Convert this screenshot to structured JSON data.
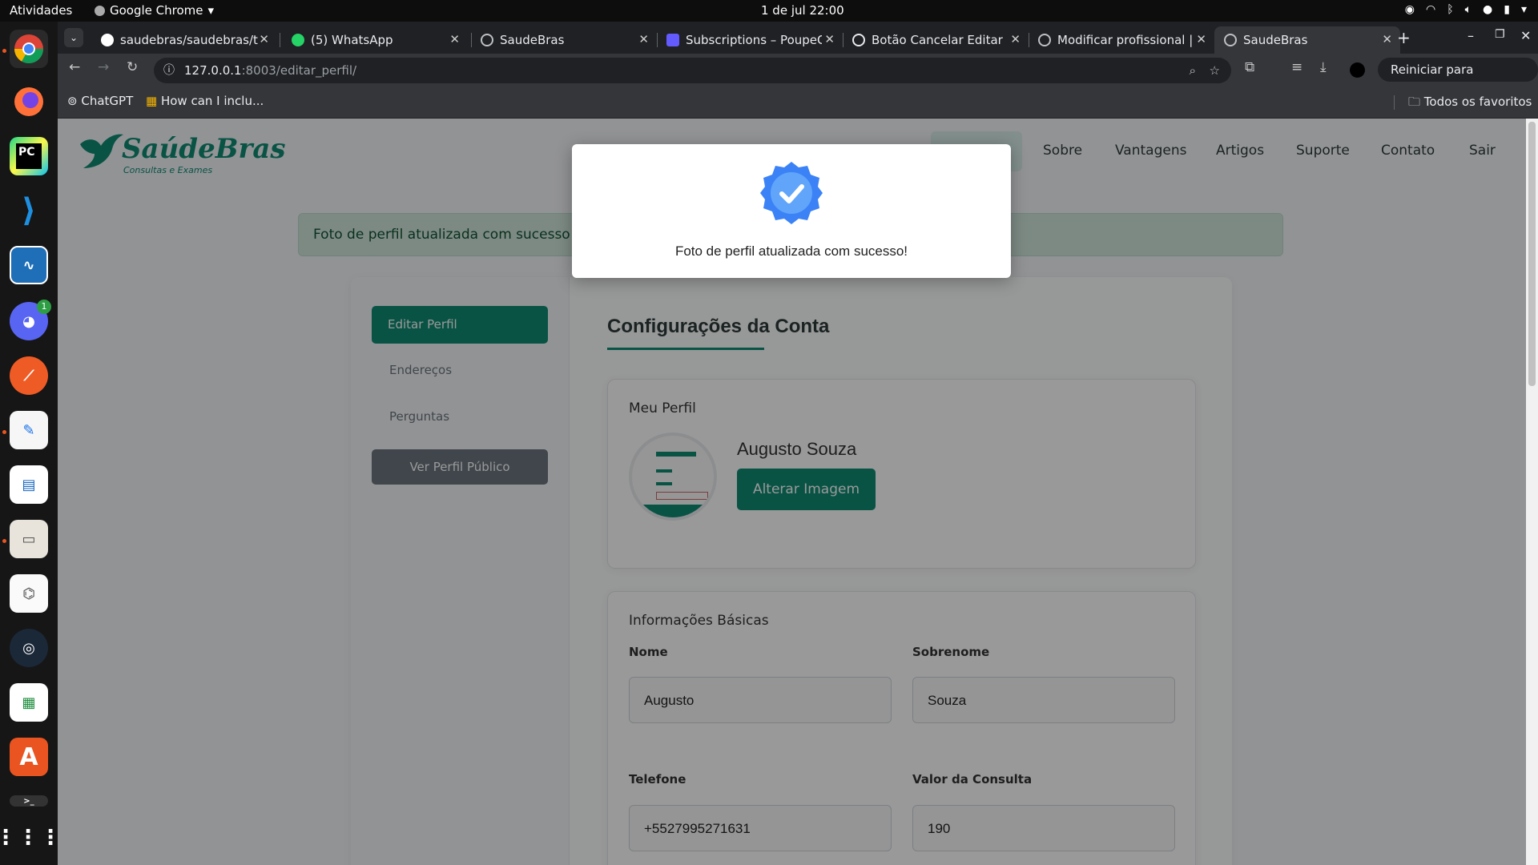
{
  "os": {
    "activities": "Atividades",
    "app_name": "Google Chrome",
    "clock": "1 de jul  22:00",
    "discord_badge": "1"
  },
  "browser": {
    "tabs": [
      {
        "title": "saudebras/saudebras/t",
        "icon": "github-icon"
      },
      {
        "title": "(5) WhatsApp",
        "icon": "whatsapp-icon"
      },
      {
        "title": "SaudeBras",
        "icon": "globe-icon"
      },
      {
        "title": "Subscriptions – PoupeC",
        "icon": "stripe-icon"
      },
      {
        "title": "Botão Cancelar Editar P",
        "icon": "chatgpt-icon"
      },
      {
        "title": "Modificar profissional |",
        "icon": "globe-icon"
      },
      {
        "title": "SaudeBras",
        "icon": "globe-icon"
      }
    ],
    "url_host": "127.0.0.1",
    "url_rest": ":8003/editar_perfil/",
    "update_button": "Reiniciar para atualizar",
    "bookmarks": [
      "ChatGPT",
      "How can I inclu..."
    ],
    "all_bookmarks": "Todos os favoritos"
  },
  "site": {
    "brand": "SaúdeBras",
    "tagline": "Consultas e Exames",
    "nav": [
      "Sobre",
      "Vantagens",
      "Artigos",
      "Suporte",
      "Contato",
      "Sair"
    ],
    "alert": "Foto de perfil atualizada com sucesso!",
    "sidebar": {
      "active": "Editar Perfil",
      "items": [
        "Endereços",
        "Perguntas"
      ],
      "public_button": "Ver Perfil Público"
    },
    "main": {
      "title": "Configurações da Conta",
      "profile_section": "Meu Perfil",
      "user_name": "Augusto Souza",
      "change_image_button": "Alterar Imagem",
      "basic_section": "Informações Básicas",
      "fields": {
        "first_name_label": "Nome",
        "first_name_value": "Augusto",
        "last_name_label": "Sobrenome",
        "last_name_value": "Souza",
        "phone_label": "Telefone",
        "phone_value": "+5527995271631",
        "price_label": "Valor da Consulta",
        "price_value": "190"
      }
    }
  },
  "modal": {
    "message": "Foto de perfil atualizada com sucesso!",
    "icon": "verified-check-icon"
  },
  "colors": {
    "brand_green": "#0f8a74",
    "badge_blue": "#3b82f6",
    "alert_bg": "#d1e7dd"
  }
}
